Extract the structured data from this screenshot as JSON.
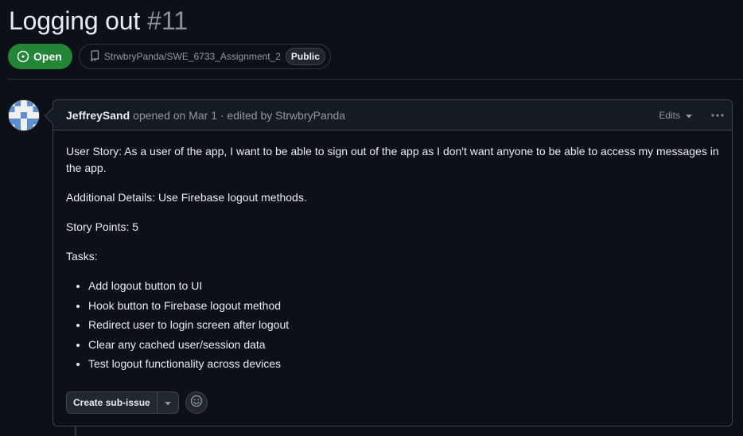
{
  "issue": {
    "title": "Logging out",
    "number": "#11",
    "state": "Open",
    "repo": "StrwbryPanda/SWE_6733_Assignment_2",
    "visibility": "Public"
  },
  "comment": {
    "author": "JeffreySand",
    "meta": "opened on Mar 1 · edited by StrwbryPanda",
    "edits_label": "Edits",
    "paragraphs": [
      "User Story: As a user of the app, I want to be able to sign out of the app as I don't want anyone to be able to access my messages in the app.",
      "Additional Details: Use Firebase logout methods.",
      "Story Points: 5",
      "Tasks:"
    ],
    "tasks": [
      "Add logout button to UI",
      "Hook button to Firebase logout method",
      "Redirect user to login screen after logout",
      "Clear any cached user/session data",
      "Test logout functionality across devices"
    ],
    "create_sub_issue_label": "Create sub-issue"
  },
  "icons": {
    "state": "issue-opened-icon",
    "repo": "repo-icon",
    "edits_caret": "triangle-down-icon",
    "menu": "kebab-horizontal-icon",
    "split_caret": "triangle-down-icon",
    "reaction": "smiley-icon"
  },
  "colors": {
    "background": "#0d1117",
    "open_badge": "#238636",
    "border": "#3d444d",
    "muted_text": "#9198a1"
  }
}
